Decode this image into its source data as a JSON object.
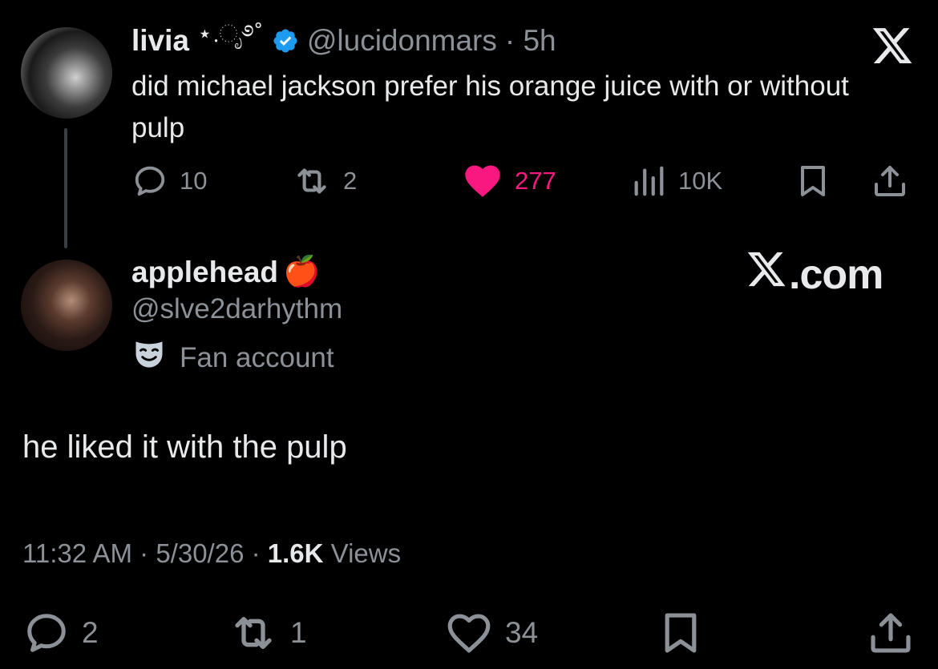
{
  "parent": {
    "name": "livia",
    "name_deco": "⋆.ೃ࿔˚",
    "handle": "@lucidonmars",
    "time": "· 5h",
    "text": "did michael jackson prefer his orange juice with or without pulp",
    "stats": {
      "replies": "10",
      "reposts": "2",
      "likes": "277",
      "views": "10K"
    }
  },
  "reply": {
    "name": "applehead",
    "name_emoji": "🍎",
    "handle": "@slve2darhythm",
    "label": "Fan account",
    "text": "he liked it with the pulp",
    "time": "11:32 AM",
    "date": "5/30/26",
    "views_count": "1.6K",
    "views_label": "Views",
    "stats": {
      "replies": "2",
      "reposts": "1",
      "likes": "34"
    }
  },
  "watermark": ".com",
  "colors": {
    "like_active": "#f91880",
    "verified": "#1d9bf0",
    "muted": "#8b9197",
    "text": "#e7e9ea",
    "background": "#000000"
  },
  "icons": [
    "x-logo-icon",
    "verified-icon",
    "reply-icon",
    "repost-icon",
    "heart-icon",
    "views-icon",
    "bookmark-icon",
    "share-icon",
    "fan-account-icon",
    "avatar"
  ]
}
